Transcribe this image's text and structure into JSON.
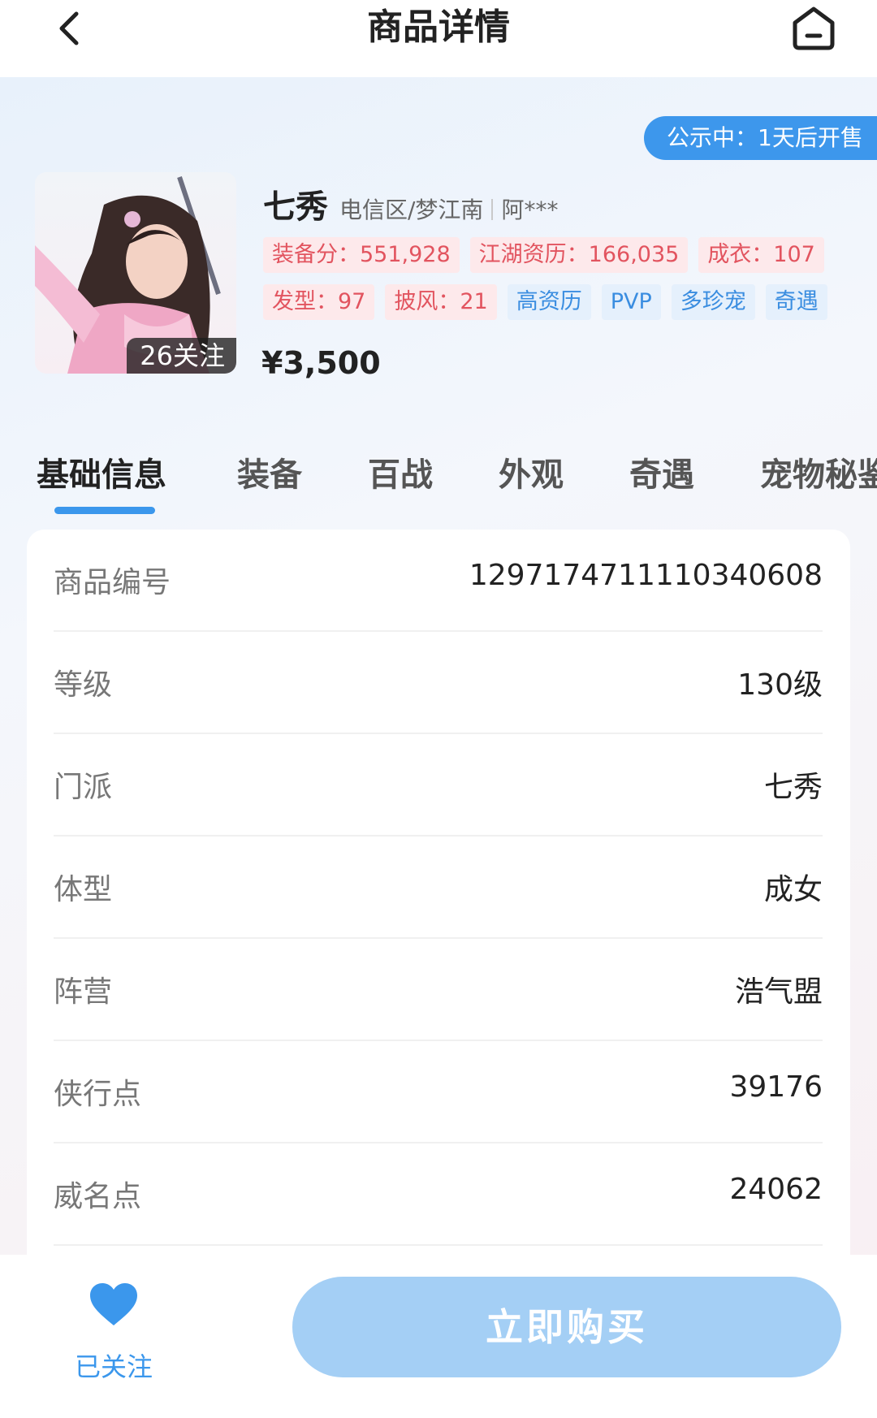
{
  "header": {
    "title": "商品详情"
  },
  "sale_notice": "公示中：1天后开售",
  "product": {
    "followers_badge": "26关注",
    "name": "七秀",
    "server": "电信区/梦江南",
    "seller": "阿***",
    "price": "¥3,500",
    "tags_row1": [
      {
        "text": "装备分：551,928",
        "style": "red"
      },
      {
        "text": "江湖资历：166,035",
        "style": "red"
      },
      {
        "text": "成衣：107",
        "style": "red"
      }
    ],
    "tags_row2": [
      {
        "text": "发型：97",
        "style": "red"
      },
      {
        "text": "披风：21",
        "style": "red"
      },
      {
        "text": "高资历",
        "style": "blue"
      },
      {
        "text": "PVP",
        "style": "blue"
      },
      {
        "text": "多珍宠",
        "style": "blue"
      },
      {
        "text": "奇遇",
        "style": "blue"
      }
    ]
  },
  "tabs": [
    "基础信息",
    "装备",
    "百战",
    "外观",
    "奇遇",
    "宠物秘鉴"
  ],
  "info_rows": [
    {
      "label": "商品编号",
      "value": "1297174711110340608"
    },
    {
      "label": "等级",
      "value": "130级"
    },
    {
      "label": "门派",
      "value": "七秀"
    },
    {
      "label": "体型",
      "value": "成女"
    },
    {
      "label": "阵营",
      "value": "浩气盟"
    },
    {
      "label": "侠行点",
      "value": "39176"
    },
    {
      "label": "威名点",
      "value": "24062"
    }
  ],
  "bottom": {
    "follow_label": "已关注",
    "buy_label": "立即购买"
  },
  "colors": {
    "accent": "#3b97ec",
    "tag_red": "#e2545f",
    "buy_button": "#a4cff5"
  }
}
